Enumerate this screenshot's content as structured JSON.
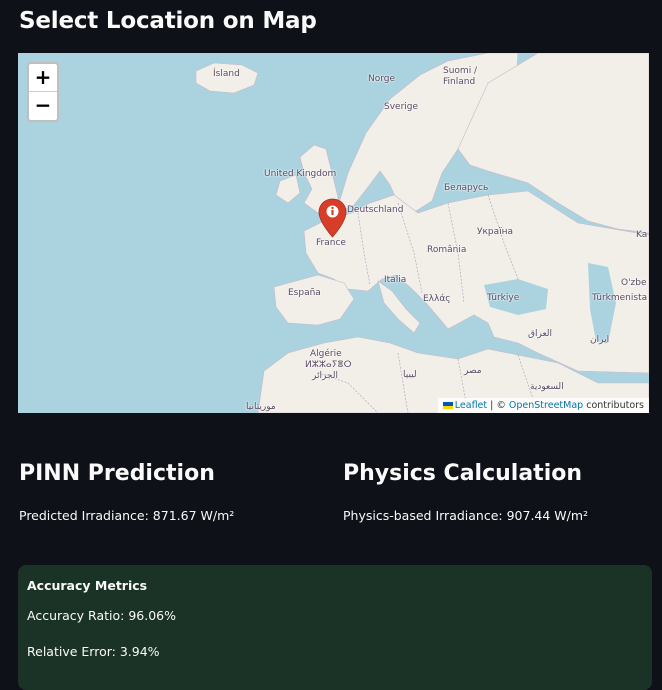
{
  "page": {
    "title": "Select Location on Map"
  },
  "map": {
    "zoom_in_label": "+",
    "zoom_out_label": "−",
    "marker_icon": "info-icon",
    "place_labels": [
      {
        "id": "island",
        "text": "Ísland"
      },
      {
        "id": "norge",
        "text": "Norge"
      },
      {
        "id": "suomi",
        "text": "Suomi /"
      },
      {
        "id": "finland",
        "text": "Finland"
      },
      {
        "id": "sverige",
        "text": "Sverige"
      },
      {
        "id": "uk",
        "text": "United Kingdom"
      },
      {
        "id": "belarus",
        "text": "Беларусь"
      },
      {
        "id": "deutschland",
        "text": "Deutschland"
      },
      {
        "id": "ukraina",
        "text": "Україна"
      },
      {
        "id": "france",
        "text": "France"
      },
      {
        "id": "romania",
        "text": "România"
      },
      {
        "id": "italia",
        "text": "Italia"
      },
      {
        "id": "espana",
        "text": "España"
      },
      {
        "id": "ellas",
        "text": "Ελλάς"
      },
      {
        "id": "turkiye",
        "text": "Türkiye"
      },
      {
        "id": "ozbe",
        "text": "O'zbe"
      },
      {
        "id": "turkmenista",
        "text": "Türkmenista"
      },
      {
        "id": "iraq",
        "text": "العراق"
      },
      {
        "id": "iran",
        "text": "ایران"
      },
      {
        "id": "algerie",
        "text": "Algérie"
      },
      {
        "id": "algerie-tif",
        "text": "ⵍⵣⵣⴰⵢⴻⵔ"
      },
      {
        "id": "algerie-ar",
        "text": "الجزائر"
      },
      {
        "id": "libya",
        "text": "ليبيا"
      },
      {
        "id": "misr",
        "text": "مصر"
      },
      {
        "id": "saudi",
        "text": "السعودية"
      },
      {
        "id": "mauritania",
        "text": "موريتانيا"
      },
      {
        "id": "ka",
        "text": "Ka"
      }
    ],
    "attribution": {
      "leaflet": "Leaflet",
      "separator": " | © ",
      "osm": "OpenStreetMap",
      "suffix": " contributors"
    }
  },
  "pinn": {
    "title": "PINN Prediction",
    "text": "Predicted Irradiance: 871.67 W/m²"
  },
  "physics": {
    "title": "Physics Calculation",
    "text": "Physics-based Irradiance: 907.44 W/m²"
  },
  "metrics": {
    "title": "Accuracy Metrics",
    "accuracy": "Accuracy Ratio: 96.06%",
    "error": "Relative Error: 3.94%"
  },
  "colors": {
    "page_bg": "#0e1117",
    "water": "#aad3df",
    "land": "#f2efe9",
    "marker": "#d63e2a",
    "metrics_bg": "#1b3327",
    "link": "#0078a8"
  }
}
